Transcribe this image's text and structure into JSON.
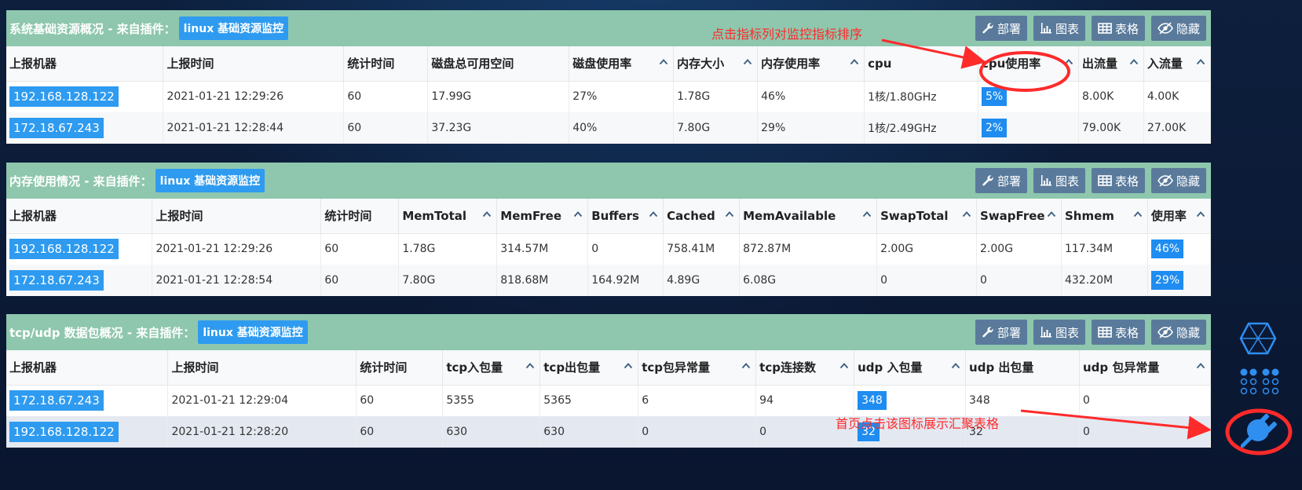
{
  "buttons": {
    "deploy": "部署",
    "chart": "图表",
    "table": "表格",
    "hide": "隐藏"
  },
  "panels": [
    {
      "title": "系统基础资源概况 - 来自插件：",
      "plugin": "linux 基础资源监控",
      "columns": [
        "上报机器",
        "上报时间",
        "统计时间",
        "磁盘总可用空间",
        "磁盘使用率",
        "内存大小",
        "内存使用率",
        "cpu",
        "cpu使用率",
        "出流量",
        "入流量"
      ],
      "rows": [
        [
          "192.168.128.122",
          "2021-01-21 12:29:26",
          "60",
          "17.99G",
          "27%",
          "1.78G",
          "46%",
          "1核/1.80GHz",
          "5%",
          "8.00K",
          "4.00K"
        ],
        [
          "172.18.67.243",
          "2021-01-21 12:28:44",
          "60",
          "37.23G",
          "40%",
          "7.80G",
          "29%",
          "1核/2.49GHz",
          "2%",
          "79.00K",
          "27.00K"
        ]
      ]
    },
    {
      "title": "内存使用情况 - 来自插件：",
      "plugin": "linux 基础资源监控",
      "columns": [
        "上报机器",
        "上报时间",
        "统计时间",
        "MemTotal",
        "MemFree",
        "Buffers",
        "Cached",
        "MemAvailable",
        "SwapTotal",
        "SwapFree",
        "Shmem",
        "使用率"
      ],
      "rows": [
        [
          "192.168.128.122",
          "2021-01-21 12:29:26",
          "60",
          "1.78G",
          "314.57M",
          "0",
          "758.41M",
          "872.87M",
          "2.00G",
          "2.00G",
          "117.34M",
          "46%"
        ],
        [
          "172.18.67.243",
          "2021-01-21 12:28:54",
          "60",
          "7.80G",
          "818.68M",
          "164.92M",
          "4.89G",
          "6.08G",
          "0",
          "0",
          "432.20M",
          "29%"
        ]
      ]
    },
    {
      "title": "tcp/udp 数据包概况 - 来自插件：",
      "plugin": "linux 基础资源监控",
      "columns": [
        "上报机器",
        "上报时间",
        "统计时间",
        "tcp入包量",
        "tcp出包量",
        "tcp包异常量",
        "tcp连接数",
        "udp 入包量",
        "udp 出包量",
        "udp 包异常量"
      ],
      "rows": [
        [
          "172.18.67.243",
          "2021-01-21 12:29:04",
          "60",
          "5355",
          "5365",
          "6",
          "94",
          "348",
          "348",
          "0"
        ],
        [
          "192.168.128.122",
          "2021-01-21 12:28:20",
          "60",
          "630",
          "630",
          "0",
          "0",
          "32",
          "32",
          "0"
        ]
      ]
    }
  ],
  "annotations": {
    "sort_hint": "点击指标列对监控指标排序",
    "icon_hint": "首页点击该图标展示汇聚表格"
  },
  "colors": {
    "header_bg": "#8ec7ad",
    "tag_blue": "#2e9bf0",
    "button_bg": "#5a7a9b",
    "annotation_red": "#ff2a2a",
    "page_bg": "#0b1a33"
  }
}
